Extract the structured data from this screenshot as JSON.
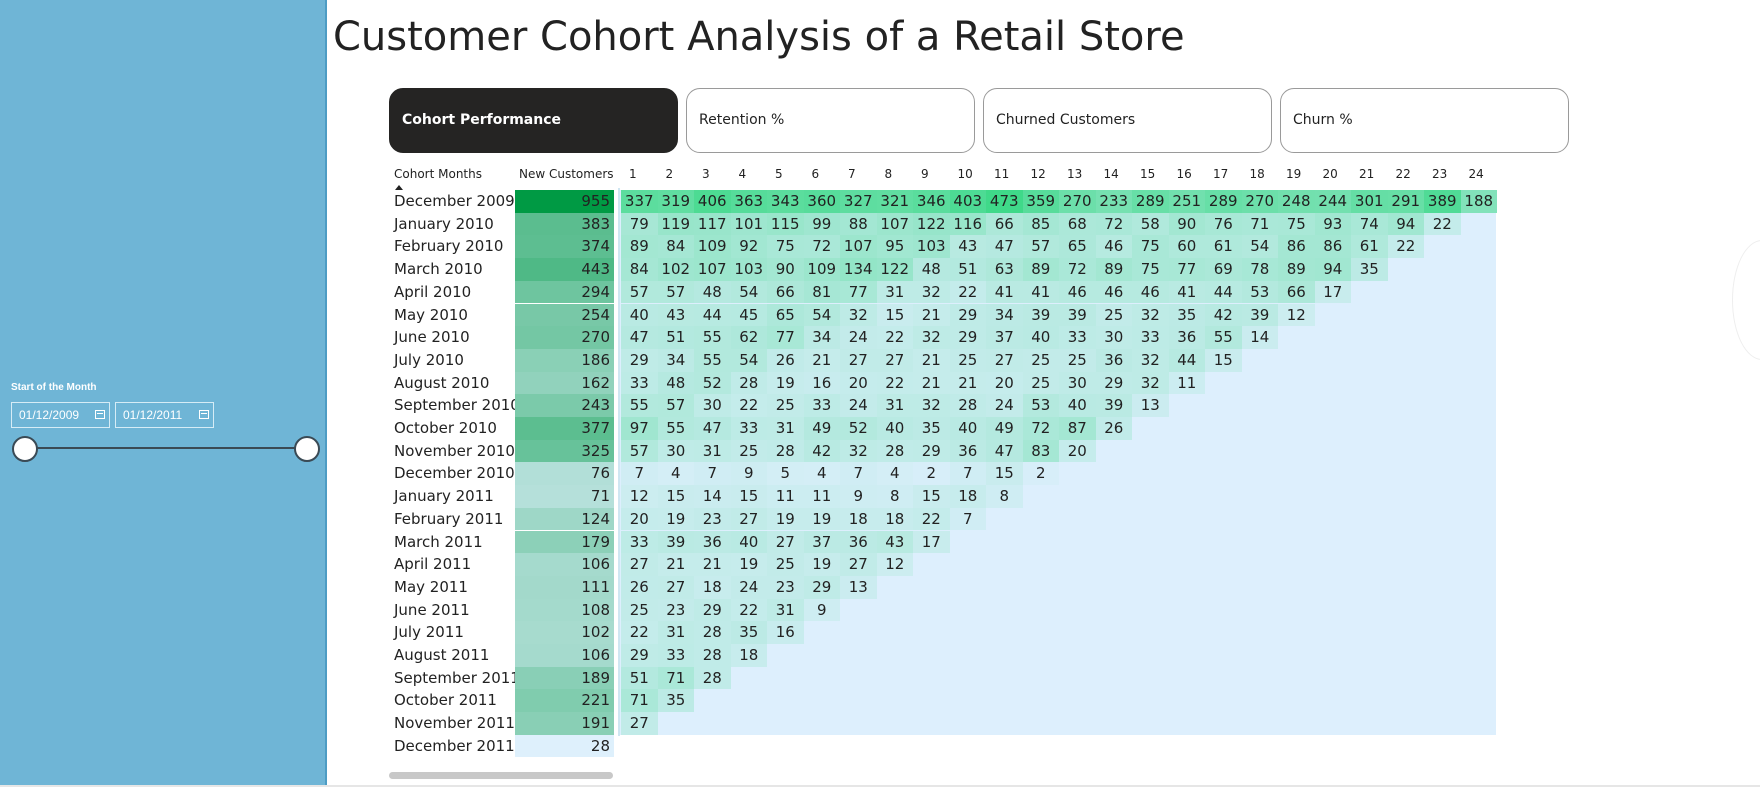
{
  "page_title": "Customer Cohort Analysis of a Retail Store",
  "slicer": {
    "title": "Start of the Month",
    "start_date": "01/12/2009",
    "end_date": "01/12/2011",
    "range_fraction": [
      0,
      1
    ]
  },
  "tabs": [
    {
      "label": "Cohort Performance",
      "active": true
    },
    {
      "label": "Retention %",
      "active": false
    },
    {
      "label": "Churned Customers",
      "active": false
    },
    {
      "label": "Churn %",
      "active": false
    }
  ],
  "matrix": {
    "header_cohort": "Cohort Months",
    "header_new": "New Customers",
    "period_headers": [
      "1",
      "2",
      "3",
      "4",
      "5",
      "6",
      "7",
      "8",
      "9",
      "10",
      "11",
      "12",
      "13",
      "14",
      "15",
      "16",
      "17",
      "18",
      "19",
      "20",
      "21",
      "22",
      "23",
      "24"
    ],
    "colors": {
      "nc_max": "#009a44",
      "nc_min": "#def0fc",
      "cell_max": "#3fd989",
      "cell_min": "#ddeffd"
    },
    "rows": [
      {
        "label": "December 2009",
        "new": 955,
        "values": [
          337,
          319,
          406,
          363,
          343,
          360,
          327,
          321,
          346,
          403,
          473,
          359,
          270,
          233,
          289,
          251,
          289,
          270,
          248,
          244,
          301,
          291,
          389,
          188
        ]
      },
      {
        "label": "January 2010",
        "new": 383,
        "values": [
          79,
          119,
          117,
          101,
          115,
          99,
          88,
          107,
          122,
          116,
          66,
          85,
          68,
          72,
          58,
          90,
          76,
          71,
          75,
          93,
          74,
          94,
          22
        ]
      },
      {
        "label": "February 2010",
        "new": 374,
        "values": [
          89,
          84,
          109,
          92,
          75,
          72,
          107,
          95,
          103,
          43,
          47,
          57,
          65,
          46,
          75,
          60,
          61,
          54,
          86,
          86,
          61,
          22
        ]
      },
      {
        "label": "March 2010",
        "new": 443,
        "values": [
          84,
          102,
          107,
          103,
          90,
          109,
          134,
          122,
          48,
          51,
          63,
          89,
          72,
          89,
          75,
          77,
          69,
          78,
          89,
          94,
          35
        ]
      },
      {
        "label": "April 2010",
        "new": 294,
        "values": [
          57,
          57,
          48,
          54,
          66,
          81,
          77,
          31,
          32,
          22,
          41,
          41,
          46,
          46,
          46,
          41,
          44,
          53,
          66,
          17
        ]
      },
      {
        "label": "May 2010",
        "new": 254,
        "values": [
          40,
          43,
          44,
          45,
          65,
          54,
          32,
          15,
          21,
          29,
          34,
          39,
          39,
          25,
          32,
          35,
          42,
          39,
          12
        ]
      },
      {
        "label": "June 2010",
        "new": 270,
        "values": [
          47,
          51,
          55,
          62,
          77,
          34,
          24,
          22,
          32,
          29,
          37,
          40,
          33,
          30,
          33,
          36,
          55,
          14
        ]
      },
      {
        "label": "July 2010",
        "new": 186,
        "values": [
          29,
          34,
          55,
          54,
          26,
          21,
          27,
          27,
          21,
          25,
          27,
          25,
          25,
          36,
          32,
          44,
          15
        ]
      },
      {
        "label": "August 2010",
        "new": 162,
        "values": [
          33,
          48,
          52,
          28,
          19,
          16,
          20,
          22,
          21,
          21,
          20,
          25,
          30,
          29,
          32,
          11
        ]
      },
      {
        "label": "September 2010",
        "new": 243,
        "values": [
          55,
          57,
          30,
          22,
          25,
          33,
          24,
          31,
          32,
          28,
          24,
          53,
          40,
          39,
          13
        ]
      },
      {
        "label": "October 2010",
        "new": 377,
        "values": [
          97,
          55,
          47,
          33,
          31,
          49,
          52,
          40,
          35,
          40,
          49,
          72,
          87,
          26
        ]
      },
      {
        "label": "November 2010",
        "new": 325,
        "values": [
          57,
          30,
          31,
          25,
          28,
          42,
          32,
          28,
          29,
          36,
          47,
          83,
          20
        ]
      },
      {
        "label": "December 2010",
        "new": 76,
        "values": [
          7,
          4,
          7,
          9,
          5,
          4,
          7,
          4,
          2,
          7,
          15,
          2
        ]
      },
      {
        "label": "January 2011",
        "new": 71,
        "values": [
          12,
          15,
          14,
          15,
          11,
          11,
          9,
          8,
          15,
          18,
          8
        ]
      },
      {
        "label": "February 2011",
        "new": 124,
        "values": [
          20,
          19,
          23,
          27,
          19,
          19,
          18,
          18,
          22,
          7
        ]
      },
      {
        "label": "March 2011",
        "new": 179,
        "values": [
          33,
          39,
          36,
          40,
          27,
          37,
          36,
          43,
          17
        ]
      },
      {
        "label": "April 2011",
        "new": 106,
        "values": [
          27,
          21,
          21,
          19,
          25,
          19,
          27,
          12
        ]
      },
      {
        "label": "May 2011",
        "new": 111,
        "values": [
          26,
          27,
          18,
          24,
          23,
          29,
          13
        ]
      },
      {
        "label": "June 2011",
        "new": 108,
        "values": [
          25,
          23,
          29,
          22,
          31,
          9
        ]
      },
      {
        "label": "July 2011",
        "new": 102,
        "values": [
          22,
          31,
          28,
          35,
          16
        ]
      },
      {
        "label": "August 2011",
        "new": 106,
        "values": [
          29,
          33,
          28,
          18
        ]
      },
      {
        "label": "September 2011",
        "new": 189,
        "values": [
          51,
          71,
          28
        ]
      },
      {
        "label": "October 2011",
        "new": 221,
        "values": [
          71,
          35
        ]
      },
      {
        "label": "November 2011",
        "new": 191,
        "values": [
          27
        ]
      },
      {
        "label": "December 2011",
        "new": 28,
        "values": []
      }
    ]
  }
}
